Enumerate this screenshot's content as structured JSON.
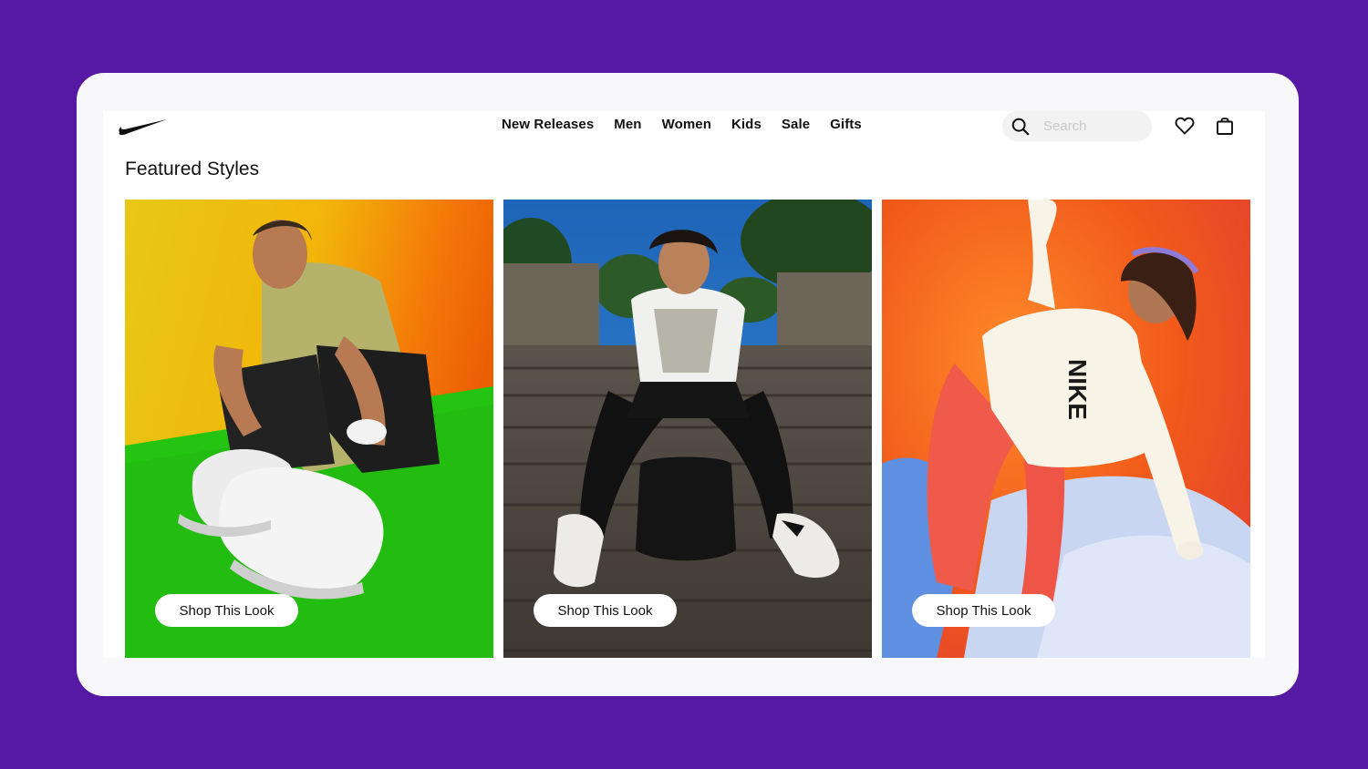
{
  "nav": {
    "links": [
      "New Releases",
      "Men",
      "Women",
      "Kids",
      "Sale",
      "Gifts"
    ]
  },
  "search": {
    "placeholder": "Search"
  },
  "icons": {
    "logo": "nike-swoosh-logo",
    "search": "search-icon",
    "favorites": "heart-icon",
    "bag": "shopping-bag-icon"
  },
  "section": {
    "title": "Featured Styles"
  },
  "cards": [
    {
      "button_label": "Shop This Look",
      "image": "man-sitting-in-white-sneakers-yellow-green-backdrop"
    },
    {
      "button_label": "Shop This Look",
      "image": "woman-sitting-on-stone-stairs-with-backpack"
    },
    {
      "button_label": "Shop This Look",
      "image": "girl-in-white-nike-sweatshirt-orange-backdrop"
    }
  ],
  "colors": {
    "background": "#5519a3",
    "frame": "#f8f8fa",
    "text": "#111111"
  }
}
